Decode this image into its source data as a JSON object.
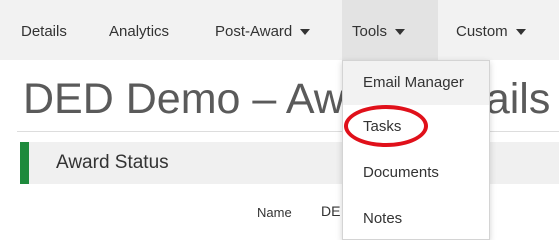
{
  "nav": {
    "details": "Details",
    "analytics": "Analytics",
    "post_award": "Post-Award",
    "tools": "Tools",
    "custom": "Custom"
  },
  "page": {
    "title": "DED Demo – Award Details"
  },
  "award_status": {
    "heading": "Award Status",
    "name_label": "Name",
    "name_value": "DE"
  },
  "tools_menu": {
    "items": [
      "Email Manager",
      "Tasks",
      "Documents",
      "Notes"
    ]
  },
  "colors": {
    "status_accent": "#1e8a3c",
    "highlight_ring": "#e0101a"
  }
}
